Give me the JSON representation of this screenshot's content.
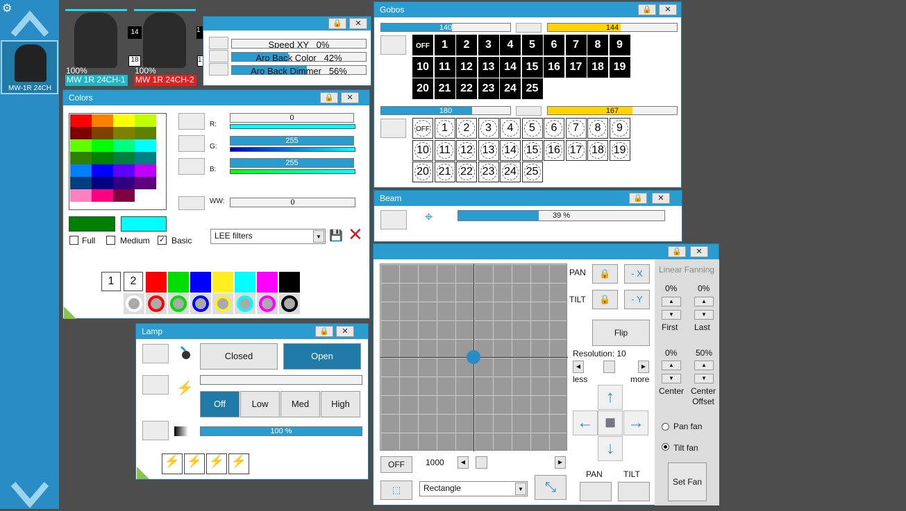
{
  "sidebar": {
    "gear": "⚙",
    "up": "▲",
    "down": "▼",
    "fixture_label": "MW-1R 24CH"
  },
  "fixtures": [
    {
      "pct": "100%",
      "name": "MW 1R 24CH-1",
      "tag_num": "14",
      "small_num": "18",
      "name_color": "#21b5c7"
    },
    {
      "pct": "100%",
      "name": "MW 1R 24CH-2",
      "tag_num": "1",
      "small_num": "1",
      "name_color": "#e32020"
    }
  ],
  "movement": {
    "speed": "Speed XY",
    "speed_val": "0%",
    "color_lbl": "Aro Back Color",
    "color_val": "42%",
    "color_level": 42,
    "dimmer_lbl": "Aro Back Dimmer",
    "dimmer_val": "56%",
    "dimmer_level": 56
  },
  "colors": {
    "title": "Colors",
    "r_lbl": "R:",
    "g_lbl": "G:",
    "b_lbl": "B:",
    "ww_lbl": "WW:",
    "r_val": "0",
    "g_val": "255",
    "b_val": "255",
    "ww_val": "0",
    "full": "Full",
    "medium": "Medium",
    "basic": "Basic",
    "filter": "LEE filters",
    "tab1": "1",
    "tab2": "2",
    "check": "✓",
    "close": "✕",
    "save": "💾"
  },
  "gobos": {
    "title": "Gobos",
    "w1": "140",
    "w1_level": 54.9,
    "w1b": "144",
    "w1b_level": 56.5,
    "w2": "180",
    "w2_level": 70.6,
    "w2b": "167",
    "w2b_level": 65.5,
    "off": "OFF",
    "nums": [
      "1",
      "2",
      "3",
      "4",
      "5",
      "6",
      "7",
      "8",
      "9",
      "10",
      "11",
      "12",
      "13",
      "14",
      "15",
      "16",
      "17",
      "18",
      "19",
      "20",
      "21",
      "22",
      "23",
      "24",
      "25"
    ]
  },
  "beam": {
    "title": "Beam",
    "val": "39 %",
    "level": 39,
    "icon": "⌖"
  },
  "lamp": {
    "title": "Lamp",
    "closed": "Closed",
    "open": "Open",
    "off": "Off",
    "low": "Low",
    "med": "Med",
    "high": "High",
    "level_val": "100 %",
    "level": 100,
    "bolt": "⚡"
  },
  "pantilt": {
    "pan": "PAN",
    "tilt": "TILT",
    "minus_x": "- X",
    "minus_y": "- Y",
    "flip": "Flip",
    "resolution": "Resolution: 10",
    "less": "less",
    "more": "more",
    "off": "OFF",
    "val1000": "1000",
    "shape": "Rectangle",
    "pan2": "PAN",
    "tilt2": "TILT",
    "fanning": "Linear Fanning",
    "first_pct": "0%",
    "last_pct": "0%",
    "first": "First",
    "last": "Last",
    "center_pct": "0%",
    "offset_pct": "50%",
    "center": "Center",
    "center_offset": "Center Offset",
    "pan_fan": "Pan fan",
    "tilt_fan": "Tilt fan",
    "set_fan": "Set Fan",
    "lock": "🔒",
    "up": "▲",
    "down": "▼",
    "left": "◀",
    "right": "▶",
    "aup": "↑",
    "adown": "↓",
    "aleft": "←",
    "aright": "→"
  },
  "win": {
    "lock": "🔒",
    "x": "✕"
  }
}
